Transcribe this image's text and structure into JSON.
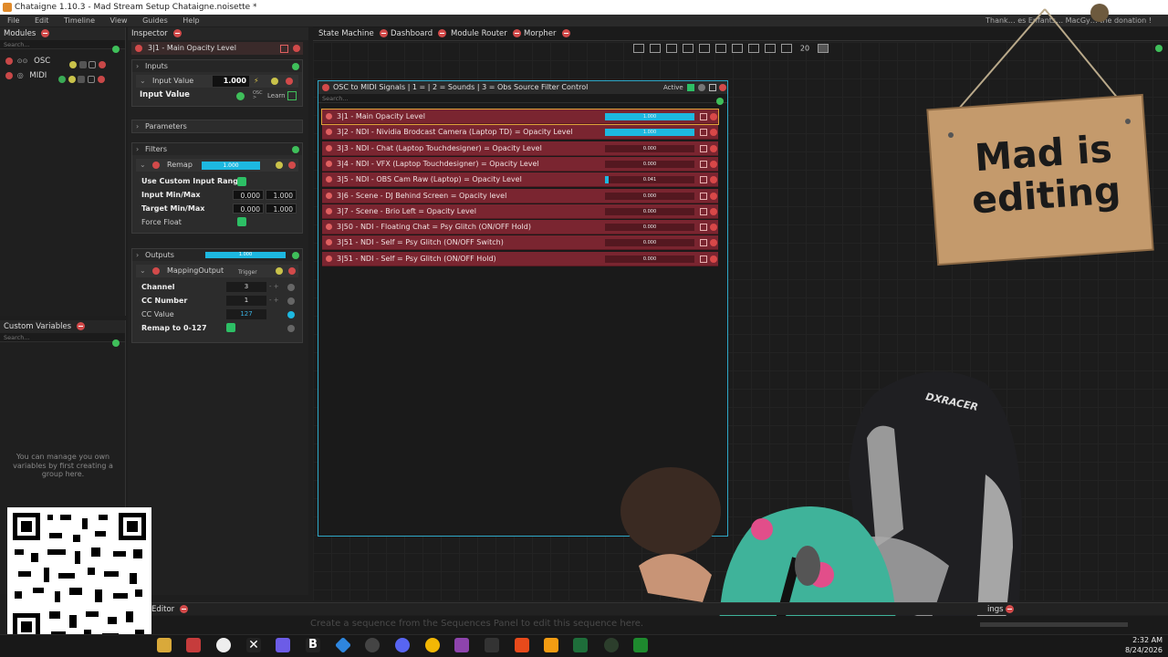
{
  "window": {
    "title": "Chataigne 1.10.3 - Mad Stream Setup Chataigne.noisette *"
  },
  "menu": {
    "items": [
      "File",
      "Edit",
      "Timeline",
      "View",
      "Guides",
      "Help"
    ],
    "thanks": "Thank… es Enfants… MacGy… the donation !"
  },
  "modules": {
    "title": "Modules",
    "search": "Search...",
    "items": [
      {
        "name": "OSC"
      },
      {
        "name": "MIDI"
      }
    ]
  },
  "custom_variables": {
    "title": "Custom Variables",
    "search": "Search...",
    "hint": "You can manage you own variables by first creating a group here."
  },
  "inspector": {
    "title": "Inspector",
    "header": "3|1 - Main Opacity Level",
    "inputs_label": "Inputs",
    "input_value_label": "Input Value",
    "input_value": "1.000",
    "input_value_bold": "Input Value",
    "osc_label": "OSC >",
    "learn_label": "Learn",
    "parameters_label": "Parameters",
    "filters_label": "Filters",
    "remap_label": "Remap",
    "remap_value": "1.000",
    "use_custom_range": "Use Custom Input Range",
    "input_minmax_label": "Input Min/Max",
    "input_min": "0.000",
    "input_max": "1.000",
    "target_minmax_label": "Target Min/Max",
    "target_min": "0.000",
    "target_max": "1.000",
    "force_float": "Force Float",
    "outputs_label": "Outputs",
    "outputs_value": "1.000",
    "mapping_output": "MappingOutput",
    "trigger": "Trigger",
    "channel_label": "Channel",
    "channel_value": "3",
    "cc_number_label": "CC Number",
    "cc_number_value": "1",
    "cc_value_label": "CC Value",
    "cc_value_value": "127",
    "remap_0_127": "Remap to 0-127"
  },
  "tabs": [
    {
      "label": "State Machine"
    },
    {
      "label": "Dashboard"
    },
    {
      "label": "Module Router"
    },
    {
      "label": "Morpher"
    }
  ],
  "toolbar": {
    "zoom": "20"
  },
  "state_machine": {
    "panel_title": "OSC to MIDI Signals | 1 =  | 2 = Sounds | 3 = Obs Source Filter Control",
    "active_label": "Active",
    "search": "Search...",
    "mappings": [
      {
        "label": "3|1 - Main Opacity Level",
        "value": "1.000",
        "level": 1.0
      },
      {
        "label": "3|2 - NDI - Nividia Brodcast Camera (Laptop TD) = Opacity Level",
        "value": "1.000",
        "level": 1.0
      },
      {
        "label": "3|3 - NDI - Chat (Laptop Touchdesigner) = Opacity Level",
        "value": "0.000",
        "level": 0
      },
      {
        "label": "3|4 - NDI - VFX (Laptop Touchdesigner) = Opacity Level",
        "value": "0.000",
        "level": 0
      },
      {
        "label": "3|5 - NDI - OBS Cam Raw (Laptop) = Opacity Level",
        "value": "0.041",
        "level": 0.041
      },
      {
        "label": "3|6 - Scene - DJ Behind Screen = Opacity level",
        "value": "0.000",
        "level": 0
      },
      {
        "label": "3|7 - Scene - Brio Left = Opacity Level",
        "value": "0.000",
        "level": 0
      },
      {
        "label": "3|50 - NDI - Floating Chat = Psy Glitch (ON/OFF Hold)",
        "value": "0.000",
        "level": 0
      },
      {
        "label": "3|51 - NDI - Self = Psy Glitch (ON/OFF Switch)",
        "value": "0.000",
        "level": 0
      },
      {
        "label": "3|51 - NDI - Self = Psy Glitch (ON/OFF Hold)",
        "value": "0.000",
        "level": 0
      }
    ]
  },
  "overlay": {
    "sign_text": "Mad is editing",
    "chair_brand": "DXRACER"
  },
  "bottom": {
    "editor_tab": "Editor",
    "sequence_hint": "Create a sequence from the Sequences Panel to edit this sequence here.",
    "sequences_tab": "ings"
  },
  "taskbar": {
    "time": "2:32 AM",
    "date": "8/24/2026"
  }
}
